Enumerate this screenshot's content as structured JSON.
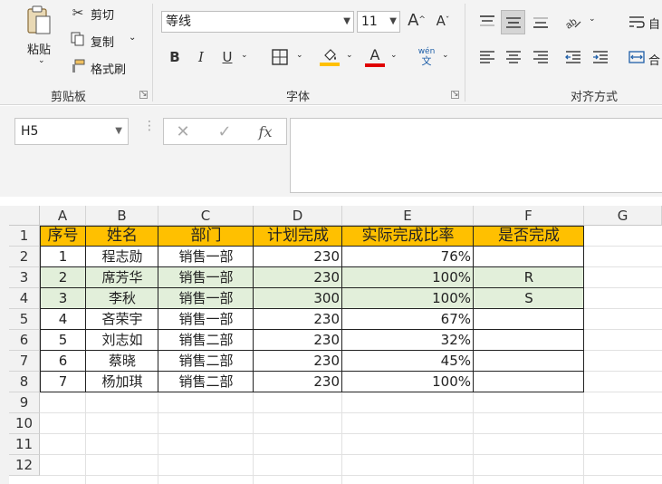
{
  "ribbon": {
    "clipboard": {
      "paste_label": "粘贴",
      "cut_label": "剪切",
      "copy_label": "复制",
      "format_painter_label": "格式刷",
      "group_label": "剪贴板"
    },
    "font": {
      "font_name": "等线",
      "font_size": "11",
      "bold": "B",
      "italic": "I",
      "underline": "U",
      "fill_color": "#ffc000",
      "font_color": "#e00000",
      "phonetic_top": "wén",
      "phonetic_bottom": "文",
      "group_label": "字体"
    },
    "alignment": {
      "group_label": "对齐方式",
      "wrap_label": "自",
      "merge_label": "合"
    }
  },
  "formula_bar": {
    "name_box": "H5",
    "fx_label": "fx"
  },
  "sheet": {
    "columns": [
      "A",
      "B",
      "C",
      "D",
      "E",
      "F",
      "G"
    ],
    "rows": [
      "1",
      "2",
      "3",
      "4",
      "5",
      "6",
      "7",
      "8",
      "9",
      "10",
      "11",
      "12"
    ],
    "header": [
      "序号",
      "姓名",
      "部门",
      "计划完成",
      "实际完成比率",
      "是否完成"
    ],
    "header_fill": "#ffc000",
    "highlight_fill": "#e2efda",
    "data": [
      [
        "1",
        "程志勋",
        "销售一部",
        "230",
        "76%",
        ""
      ],
      [
        "2",
        "席芳华",
        "销售一部",
        "230",
        "100%",
        "R"
      ],
      [
        "3",
        "李秋",
        "销售一部",
        "300",
        "100%",
        "S"
      ],
      [
        "4",
        "吝荣宇",
        "销售一部",
        "230",
        "67%",
        ""
      ],
      [
        "5",
        "刘志如",
        "销售二部",
        "230",
        "32%",
        ""
      ],
      [
        "6",
        "蔡晓",
        "销售二部",
        "230",
        "45%",
        ""
      ],
      [
        "7",
        "杨加琪",
        "销售二部",
        "230",
        "100%",
        ""
      ]
    ]
  }
}
